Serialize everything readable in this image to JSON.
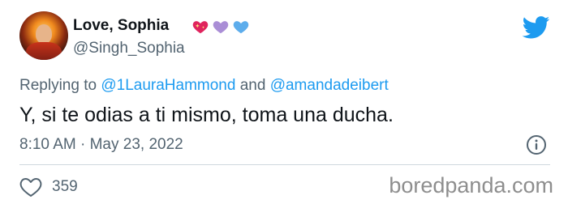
{
  "author": {
    "display_name": "Love, Sophia",
    "handle": "@Singh_Sophia",
    "name_emojis": [
      "sparkling-heart",
      "purple-heart",
      "blue-heart"
    ]
  },
  "reply": {
    "prefix": "Replying to",
    "mention_1": "@1LauraHammond",
    "conjunction": "and",
    "mention_2": "@amandadeibert"
  },
  "tweet": {
    "text": "Y, si te odias a ti mismo, toma una ducha.",
    "timestamp": "8:10 AM · May 23, 2022"
  },
  "engagement": {
    "likes": "359"
  },
  "watermark": "boredpanda.com",
  "colors": {
    "twitter_blue": "#1d9bf0",
    "secondary_text": "#536471",
    "primary_text": "#0f1419",
    "divider": "#cfd9de"
  }
}
